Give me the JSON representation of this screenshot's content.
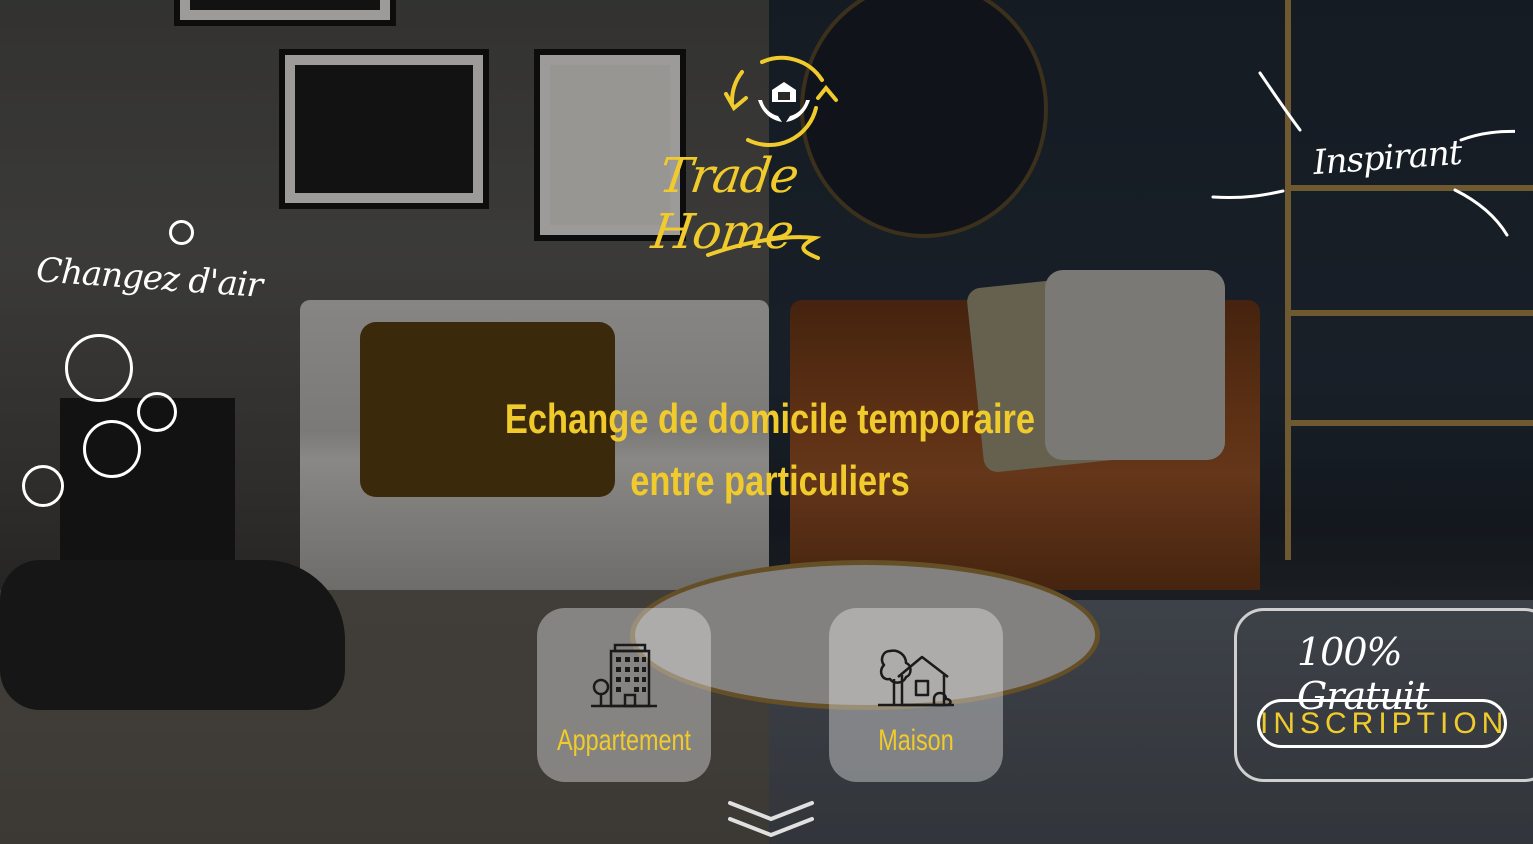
{
  "brand": {
    "name": "Trade Home",
    "logo_icon": "hands-house-exchange-icon"
  },
  "taglines": {
    "left": "Changez d'air",
    "right": "Inspirant"
  },
  "hero": {
    "line1": "Echange de domicile temporaire",
    "line2": "entre particuliers"
  },
  "property_types": [
    {
      "label": "Appartement",
      "icon": "apartment-building-icon"
    },
    {
      "label": "Maison",
      "icon": "house-with-tree-icon"
    }
  ],
  "promo": {
    "text": "100% Gratuit",
    "button_label": "INSCRIPTION"
  },
  "scroll": {
    "icon": "double-chevron-down-icon"
  },
  "colors": {
    "accent": "#f1cb2b",
    "white": "#ffffff"
  }
}
